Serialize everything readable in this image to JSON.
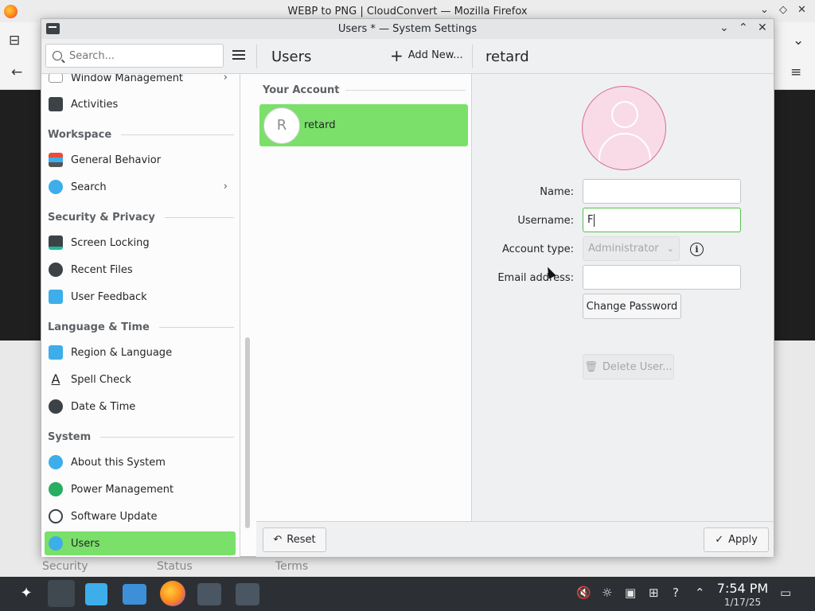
{
  "firefox": {
    "window_title": "WEBP to PNG | CloudConvert — Mozilla Firefox",
    "page_footer": [
      "Security",
      "Status",
      "Terms"
    ]
  },
  "window": {
    "title": "Users * — System Settings"
  },
  "header": {
    "search_placeholder": "Search...",
    "page_title": "Users",
    "add_new_label": "Add New...",
    "selected_user": "retard"
  },
  "sidebar": {
    "items_top": [
      {
        "label": "Window Management",
        "icon": "window-icon",
        "chevron": true
      },
      {
        "label": "Activities",
        "icon": "activities-icon",
        "chevron": false
      }
    ],
    "sections": [
      {
        "title": "Workspace",
        "items": [
          {
            "label": "General Behavior",
            "icon": "general-behavior-icon",
            "chevron": false
          },
          {
            "label": "Search",
            "icon": "search-icon",
            "chevron": true
          }
        ]
      },
      {
        "title": "Security & Privacy",
        "items": [
          {
            "label": "Screen Locking",
            "icon": "lock-screen-icon",
            "chevron": false
          },
          {
            "label": "Recent Files",
            "icon": "clock-icon",
            "chevron": false
          },
          {
            "label": "User Feedback",
            "icon": "feedback-icon",
            "chevron": false
          }
        ]
      },
      {
        "title": "Language & Time",
        "items": [
          {
            "label": "Region & Language",
            "icon": "region-icon",
            "chevron": false
          },
          {
            "label": "Spell Check",
            "icon": "spell-check-icon",
            "chevron": false
          },
          {
            "label": "Date & Time",
            "icon": "clock-icon",
            "chevron": false
          }
        ]
      },
      {
        "title": "System",
        "items": [
          {
            "label": "About this System",
            "icon": "info-icon",
            "chevron": false
          },
          {
            "label": "Power Management",
            "icon": "power-icon",
            "chevron": false
          },
          {
            "label": "Software Update",
            "icon": "update-icon",
            "chevron": false
          },
          {
            "label": "Users",
            "icon": "users-icon",
            "chevron": false,
            "active": true
          }
        ]
      }
    ]
  },
  "accounts": {
    "section_title": "Your Account",
    "current": {
      "initial": "R",
      "name": "retard"
    }
  },
  "details": {
    "name_label": "Name:",
    "name_value": "",
    "username_label": "Username:",
    "username_value": "F",
    "account_type_label": "Account type:",
    "account_type_value": "Administrator",
    "email_label": "Email address:",
    "email_value": "",
    "change_password_label": "Change Password",
    "delete_user_label": "Delete User..."
  },
  "footer": {
    "reset_label": "Reset",
    "apply_label": "Apply"
  },
  "taskbar": {
    "time": "7:54 PM",
    "date": "1/17/25"
  },
  "colors": {
    "accent": "#7ae06a",
    "avatar_bg": "#f8dbe7",
    "avatar_border": "#d46d99"
  }
}
